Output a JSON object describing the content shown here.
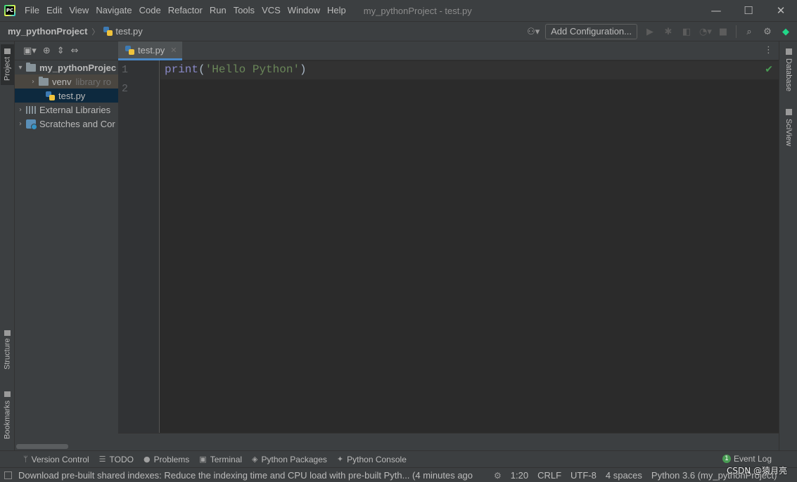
{
  "app": {
    "window_title": "my_pythonProject - test.py",
    "menu": [
      "File",
      "Edit",
      "View",
      "Navigate",
      "Code",
      "Refactor",
      "Run",
      "Tools",
      "VCS",
      "Window",
      "Help"
    ],
    "window_controls": {
      "minimize": "—",
      "maximize": "☐",
      "close": "✕"
    }
  },
  "navbar": {
    "project": "my_pythonProject",
    "file": "test.py",
    "add_configuration": "Add Configuration..."
  },
  "left_strip": {
    "project": "Project",
    "structure": "Structure",
    "bookmarks": "Bookmarks"
  },
  "project_tree": [
    {
      "label": "my_pythonProjec",
      "arrow": "▾",
      "kind": "root"
    },
    {
      "label": "venv",
      "note": "library ro",
      "arrow": "›",
      "kind": "folder-excluded"
    },
    {
      "label": "test.py",
      "arrow": "",
      "kind": "file-selected"
    },
    {
      "label": "External Libraries",
      "arrow": "›",
      "kind": "libraries"
    },
    {
      "label": "Scratches and Cor",
      "arrow": "›",
      "kind": "scratches"
    }
  ],
  "editor": {
    "tab_label": "test.py",
    "lines": [
      "1",
      "2"
    ],
    "code": {
      "func": "print",
      "open": "(",
      "string": "'Hello Python'",
      "close": ")"
    }
  },
  "right_strip": {
    "database": "Database",
    "sciview": "SciView"
  },
  "tool_tabs": [
    {
      "label": "Version Control",
      "icon": "branch-icon"
    },
    {
      "label": "TODO",
      "icon": "list-icon"
    },
    {
      "label": "Problems",
      "icon": "info-icon"
    },
    {
      "label": "Terminal",
      "icon": "terminal-icon"
    },
    {
      "label": "Python Packages",
      "icon": "packages-icon"
    },
    {
      "label": "Python Console",
      "icon": "python-console-icon"
    }
  ],
  "event_log": {
    "label": "Event Log",
    "count": "1"
  },
  "status": {
    "message": "Download pre-built shared indexes: Reduce the indexing time and CPU load with pre-built Pyth... (4 minutes ago",
    "position": "1:20",
    "line_sep": "CRLF",
    "encoding": "UTF-8",
    "indent": "4 spaces",
    "interpreter": "Python 3.6 (my_pythonProject)"
  },
  "watermark": "CSDN @猿月亮",
  "colors": {
    "accent": "#4a88c7",
    "editor_bg": "#2b2b2b",
    "panel_bg": "#3c3f41",
    "selection": "#0d293e",
    "ok": "#499c54"
  }
}
